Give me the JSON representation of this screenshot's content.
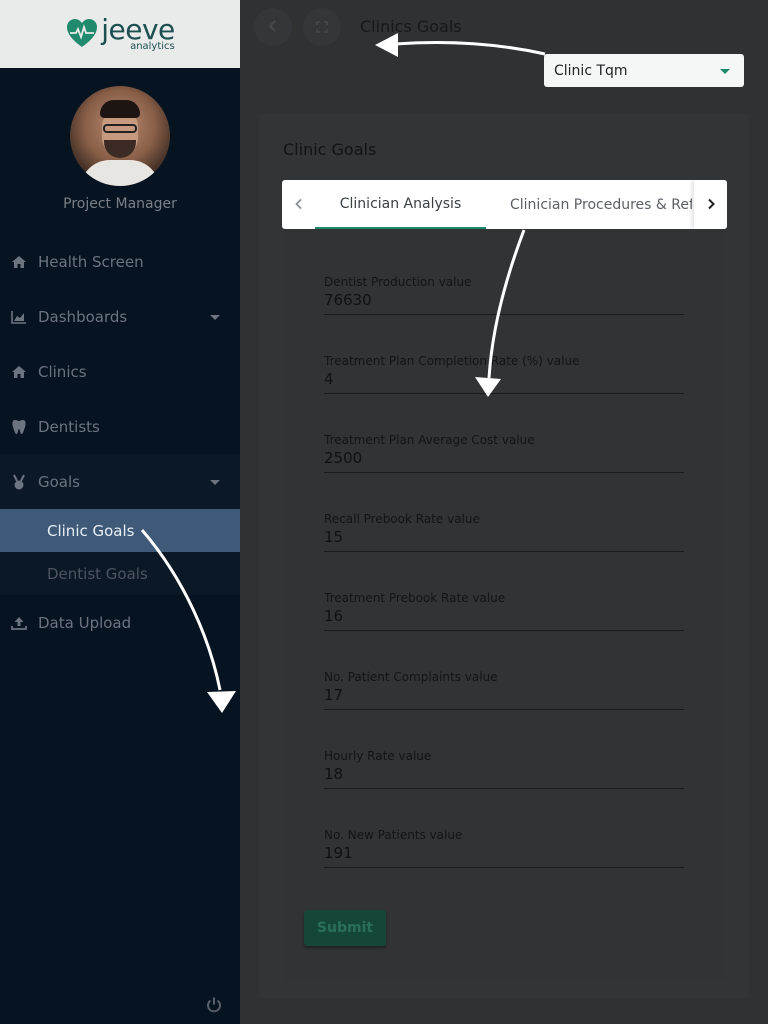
{
  "brand": {
    "name": "jeeve",
    "tagline": "analytics"
  },
  "profile": {
    "role": "Project Manager"
  },
  "nav": {
    "items": [
      {
        "label": "Health Screen",
        "icon": "home-icon"
      },
      {
        "label": "Dashboards",
        "icon": "chart-icon"
      },
      {
        "label": "Clinics",
        "icon": "home-icon"
      },
      {
        "label": "Dentists",
        "icon": "tooth-icon"
      },
      {
        "label": "Goals",
        "icon": "medal-icon"
      },
      {
        "label": "Data Upload",
        "icon": "upload-icon"
      }
    ],
    "goals_sub": [
      {
        "label": "Clinic Goals",
        "active": true
      },
      {
        "label": "Dentist Goals",
        "active": false
      }
    ]
  },
  "header": {
    "title": "Clinics Goals",
    "clinic_select": "Clinic Tqm"
  },
  "card": {
    "title": "Clinic Goals",
    "tabs": [
      "Clinician Analysis",
      "Clinician Procedures & Referrals"
    ],
    "fields": [
      {
        "label": "Dentist Production value",
        "value": "76630"
      },
      {
        "label": "Treatment Plan Completion Rate (%) value",
        "value": "4"
      },
      {
        "label": "Treatment Plan Average Cost value",
        "value": "2500"
      },
      {
        "label": "Recall Prebook Rate value",
        "value": "15"
      },
      {
        "label": "Treatment Prebook Rate value",
        "value": "16"
      },
      {
        "label": "No. Patient Complaints value",
        "value": "17"
      },
      {
        "label": "Hourly Rate value",
        "value": "18"
      },
      {
        "label": "No. New Patients value",
        "value": "191"
      }
    ],
    "submit_label": "Submit"
  },
  "colors": {
    "sidebar_bg": "#061320",
    "active_item_bg": "#3e5a78",
    "accent_green": "#1d8a6c",
    "overlay_bg": "#2f3133"
  }
}
